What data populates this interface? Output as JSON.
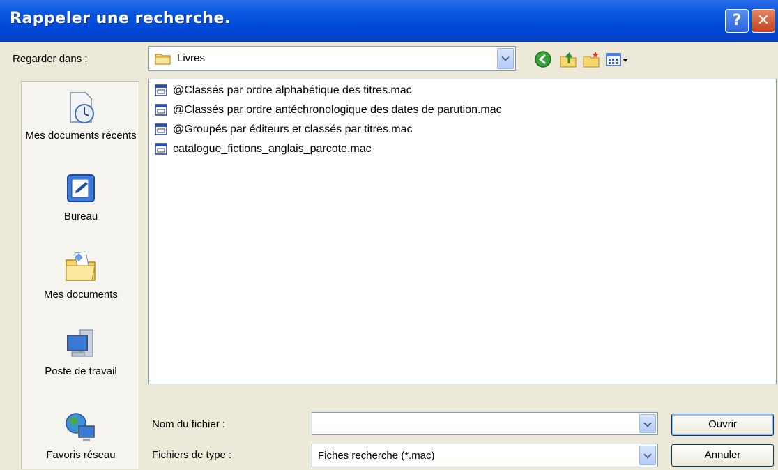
{
  "window": {
    "title": "Rappeler une recherche.",
    "help_label": "?",
    "close_label": "✕"
  },
  "look_in": {
    "label": "Regarder dans :",
    "value": "Livres"
  },
  "toolbar": {
    "icons": [
      "back-icon",
      "up-folder-icon",
      "new-folder-icon",
      "view-menu-icon"
    ]
  },
  "places": [
    {
      "label": "Mes documents récents",
      "icon": "recent-documents-icon"
    },
    {
      "label": "Bureau",
      "icon": "desktop-icon"
    },
    {
      "label": "Mes documents",
      "icon": "my-documents-icon"
    },
    {
      "label": "Poste de travail",
      "icon": "my-computer-icon"
    },
    {
      "label": "Favoris réseau",
      "icon": "network-places-icon"
    }
  ],
  "files": [
    {
      "name": "@Classés par ordre alphabétique des titres.mac"
    },
    {
      "name": "@Classés par ordre antéchronologique des dates de parution.mac"
    },
    {
      "name": "@Groupés par éditeurs et classés par titres.mac"
    },
    {
      "name": "catalogue_fictions_anglais_parcote.mac"
    }
  ],
  "form": {
    "filename_label": "Nom du fichier :",
    "filename_value": "",
    "filetype_label": "Fichiers de type :",
    "filetype_value": "Fiches recherche (*.mac)"
  },
  "buttons": {
    "open": "Ouvrir",
    "cancel": "Annuler"
  }
}
